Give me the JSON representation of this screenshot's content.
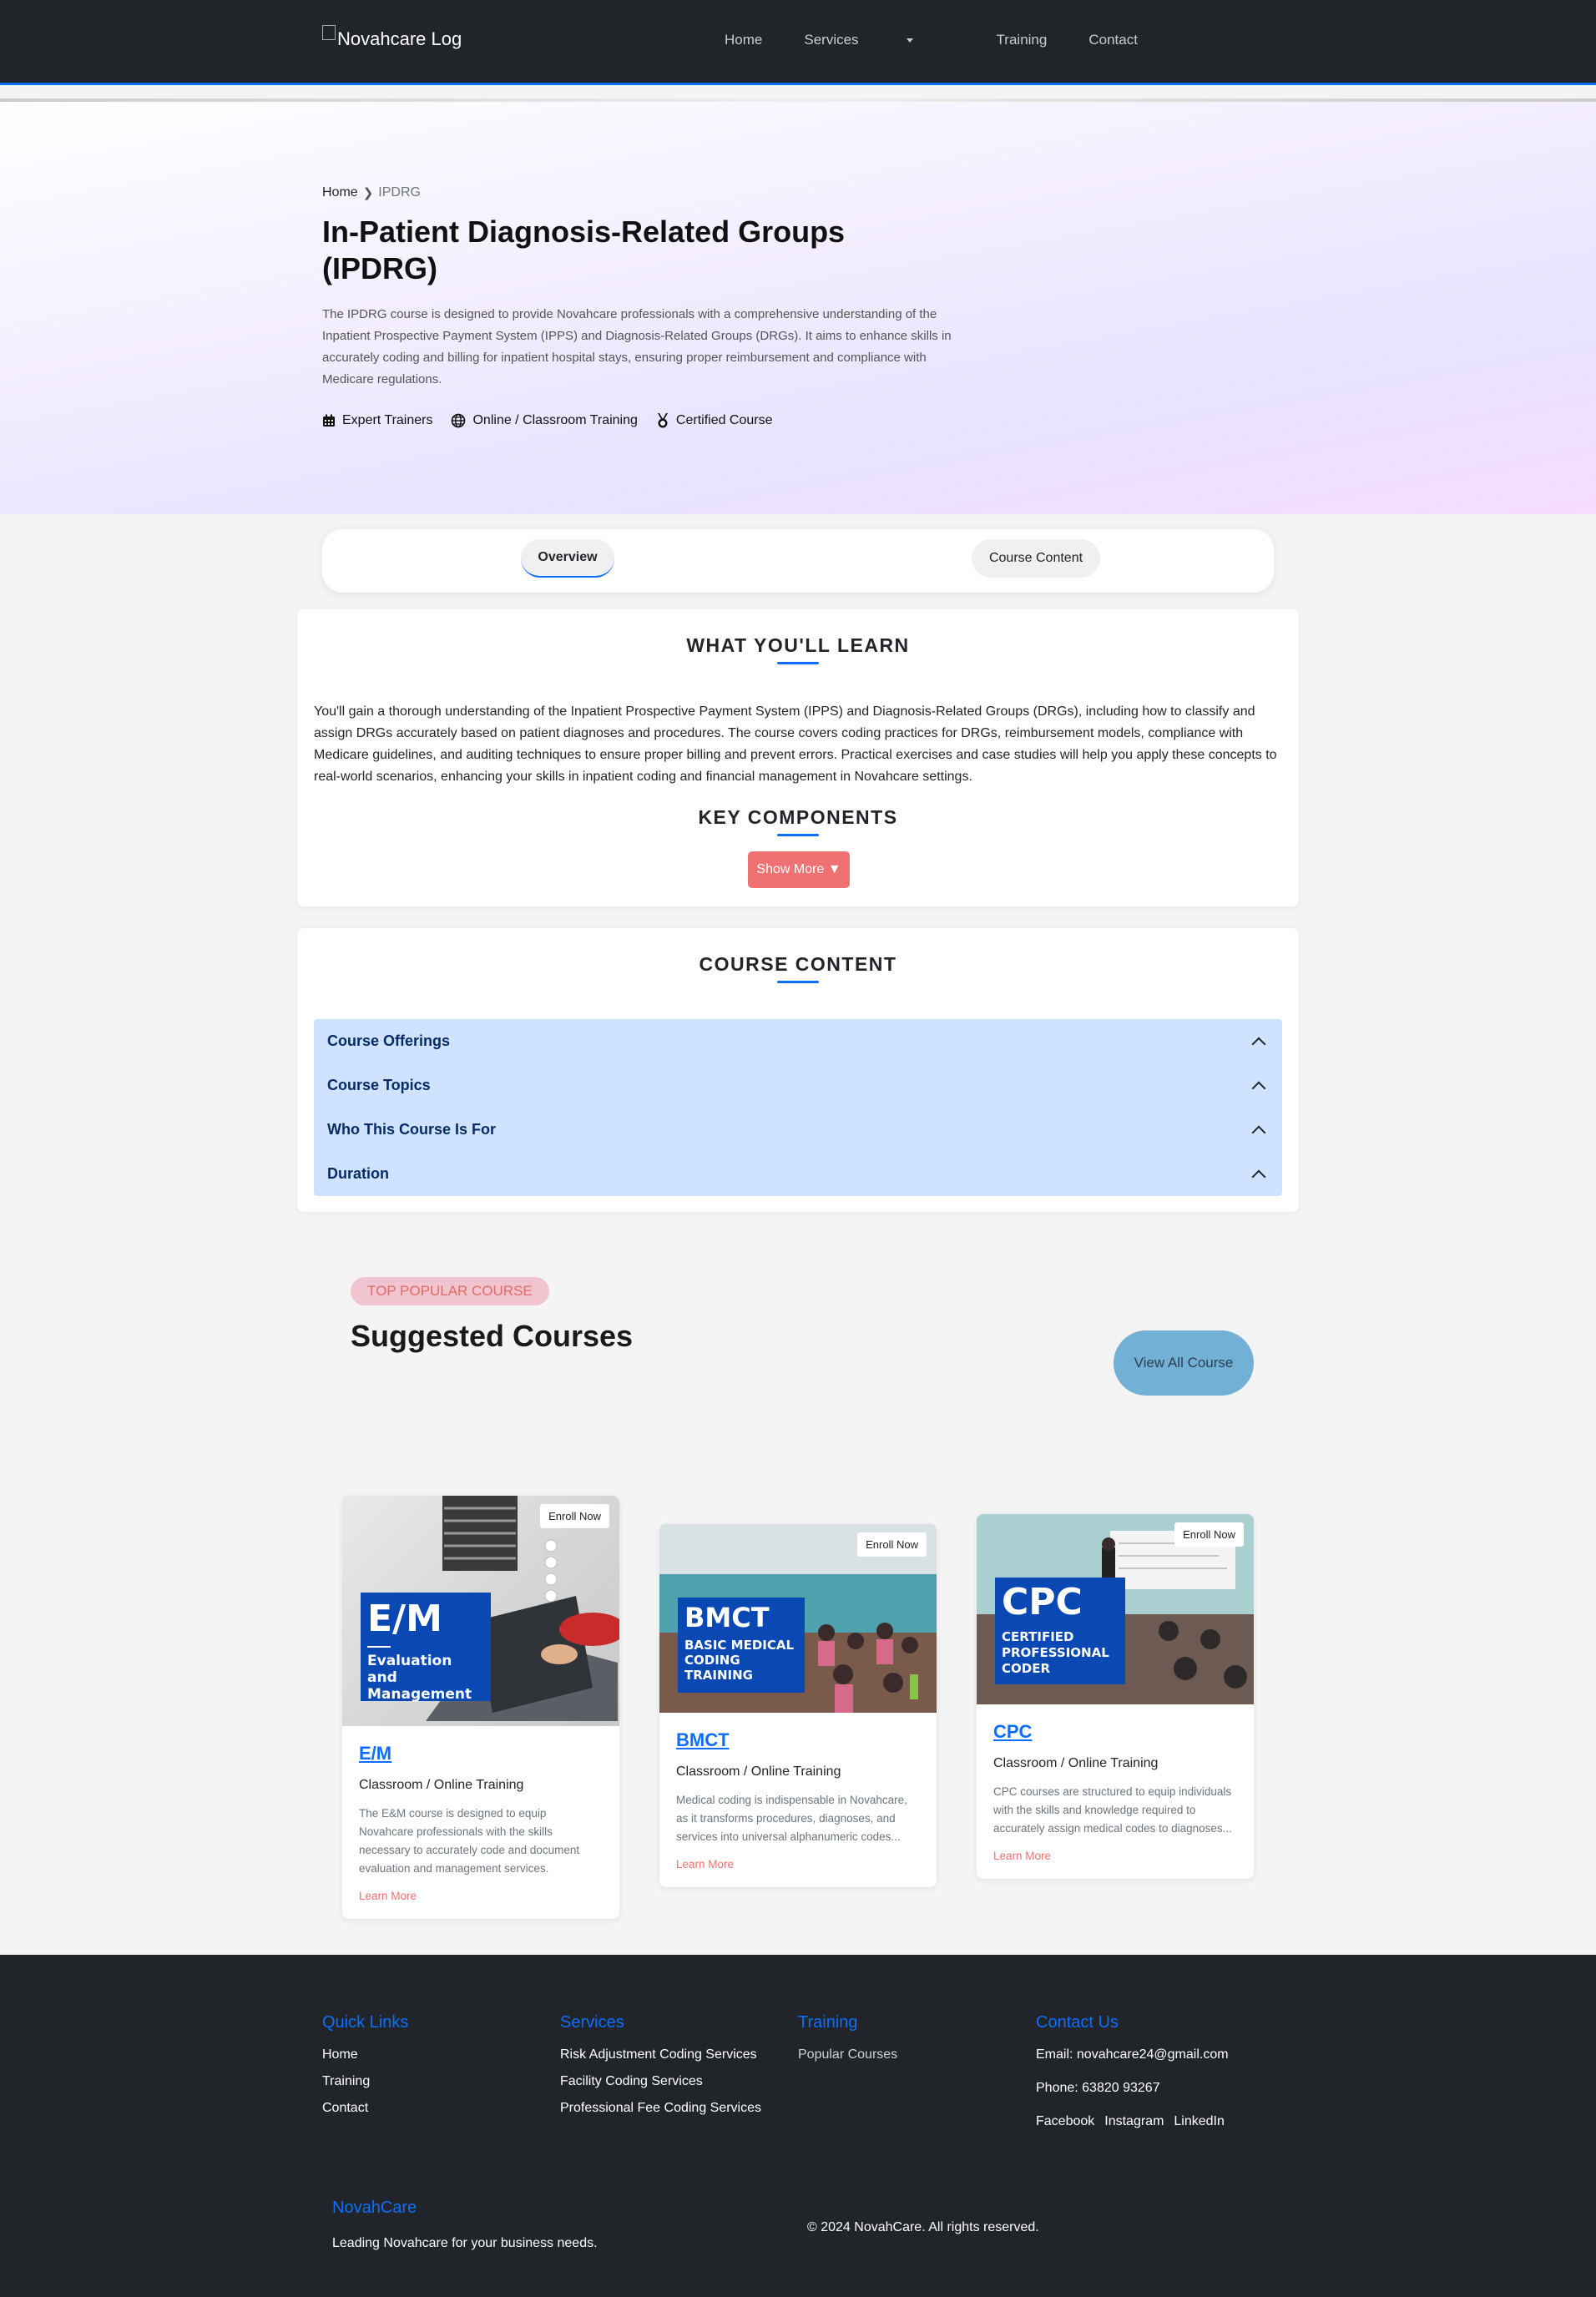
{
  "navbar": {
    "logo_alt": "Novahcare Log",
    "links": [
      "Home",
      "Services",
      "Training",
      "Contact"
    ]
  },
  "hero": {
    "breadcrumb_home": "Home",
    "breadcrumb_current": "IPDRG",
    "title": "In-Patient Diagnosis-Related Groups (IPDRG)",
    "description": "The IPDRG course is designed to provide Novahcare professionals with a comprehensive understanding of the Inpatient Prospective Payment System (IPPS) and Diagnosis-Related Groups (DRGs). It aims to enhance skills in accurately coding and billing for inpatient hospital stays, ensuring proper reimbursement and compliance with Medicare regulations.",
    "features": [
      {
        "icon": "calendar-icon",
        "label": "Expert Trainers"
      },
      {
        "icon": "globe-icon",
        "label": "Online / Classroom Training"
      },
      {
        "icon": "medal-icon",
        "label": "Certified Course"
      }
    ]
  },
  "tabs": {
    "overview": "Overview",
    "course_content": "Course Content"
  },
  "learn": {
    "heading": "WHAT YOU'LL LEARN",
    "text": "You'll gain a thorough understanding of the Inpatient Prospective Payment System (IPPS) and Diagnosis-Related Groups (DRGs), including how to classify and assign DRGs accurately based on patient diagnoses and procedures. The course covers coding practices for DRGs, reimbursement models, compliance with Medicare guidelines, and auditing techniques to ensure proper billing and prevent errors. Practical exercises and case studies will help you apply these concepts to real-world scenarios, enhancing your skills in inpatient coding and financial management in Novahcare settings.",
    "components_heading": "KEY COMPONENTS",
    "show_more": "Show More ▼"
  },
  "content": {
    "heading": "COURSE CONTENT",
    "items": [
      "Course Offerings",
      "Course Topics",
      "Who This Course Is For",
      "Duration"
    ]
  },
  "suggested": {
    "pill": "TOP POPULAR COURSE",
    "title": "Suggested Courses",
    "view_all": "View All Course",
    "enroll_label": "Enroll Now",
    "courses": [
      {
        "badge_big": "E/M",
        "badge_small": "Evaluation and Management",
        "name": "E/M",
        "mode": "Classroom / Online Training",
        "desc": "The E&M course is designed to equip Novahcare professionals with the skills necessary to accurately code and document evaluation and management services.",
        "link": "Learn More"
      },
      {
        "badge_big": "BMCT",
        "badge_small": "BASIC MEDICAL CODING TRAINING",
        "name": "BMCT",
        "mode": "Classroom / Online Training",
        "desc": "Medical coding is indispensable in Novahcare, as it transforms procedures, diagnoses, and services into universal alphanumeric codes...",
        "link": "Learn More"
      },
      {
        "badge_big": "CPC",
        "badge_small": "CERTIFIED PROFESSIONAL CODER",
        "name": "CPC",
        "mode": "Classroom / Online Training",
        "desc": "CPC courses are structured to equip individuals with the skills and knowledge required to accurately assign medical codes to diagnoses...",
        "link": "Learn More"
      }
    ]
  },
  "footer": {
    "quick_links": {
      "title": "Quick Links",
      "items": [
        "Home",
        "Training",
        "Contact"
      ]
    },
    "services": {
      "title": "Services",
      "items": [
        "Risk Adjustment Coding Services",
        "Facility Coding Services",
        "Professional Fee Coding Services"
      ]
    },
    "training": {
      "title": "Training",
      "items": [
        "Popular Courses"
      ]
    },
    "contact": {
      "title": "Contact Us",
      "email": "Email: novahcare24@gmail.com",
      "phone": "Phone: 63820 93267",
      "socials": [
        "Facebook",
        "Instagram",
        "LinkedIn"
      ]
    },
    "brand": "NovahCare",
    "tagline": "Leading Novahcare for your business needs.",
    "copyright": "© 2024 NovahCare. All rights reserved."
  }
}
